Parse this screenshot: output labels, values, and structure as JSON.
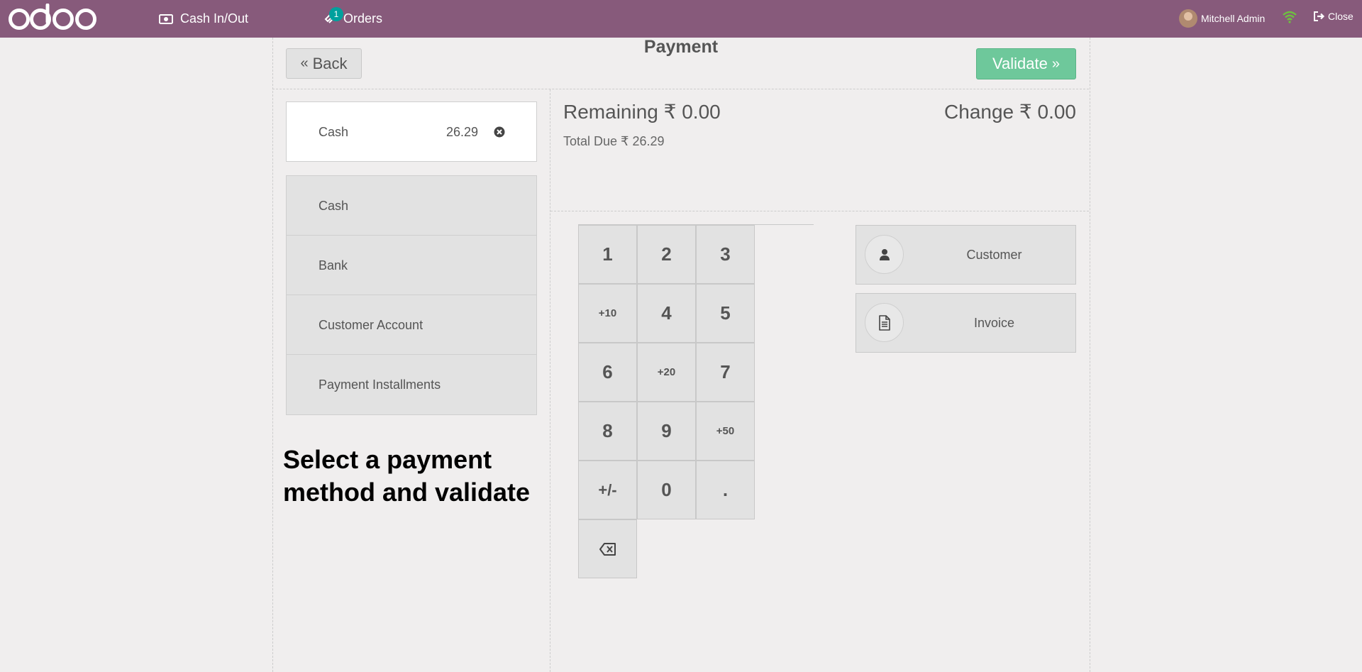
{
  "topbar": {
    "logo_text": "odoo",
    "cash_inout_label": "Cash In/Out",
    "orders_label": "Orders",
    "orders_badge": "1",
    "user_name": "Mitchell Admin",
    "close_label": "Close",
    "bar_color": "#875a7b"
  },
  "screen": {
    "title": "Payment",
    "back_label": "Back",
    "validate_label": "Validate"
  },
  "payment_lines": [
    {
      "name": "Cash",
      "amount": "26.29"
    }
  ],
  "payment_methods": [
    {
      "label": "Cash"
    },
    {
      "label": "Bank"
    },
    {
      "label": "Customer Account"
    },
    {
      "label": "Payment Installments"
    }
  ],
  "hint_text": "Select a payment method and validate",
  "status": {
    "remaining": "Remaining ₹ 0.00",
    "change": "Change ₹ 0.00",
    "total_due": "Total Due  ₹ 26.29"
  },
  "numpad": {
    "keys": [
      "1",
      "2",
      "3",
      "+10",
      "4",
      "5",
      "6",
      "+20",
      "7",
      "8",
      "9",
      "+50",
      "+/-",
      "0",
      "."
    ]
  },
  "side_buttons": {
    "customer_label": "Customer",
    "invoice_label": "Invoice"
  },
  "colors": {
    "validate": "#6ec89b",
    "badge": "#00a09d",
    "wifi": "#6ec040"
  }
}
